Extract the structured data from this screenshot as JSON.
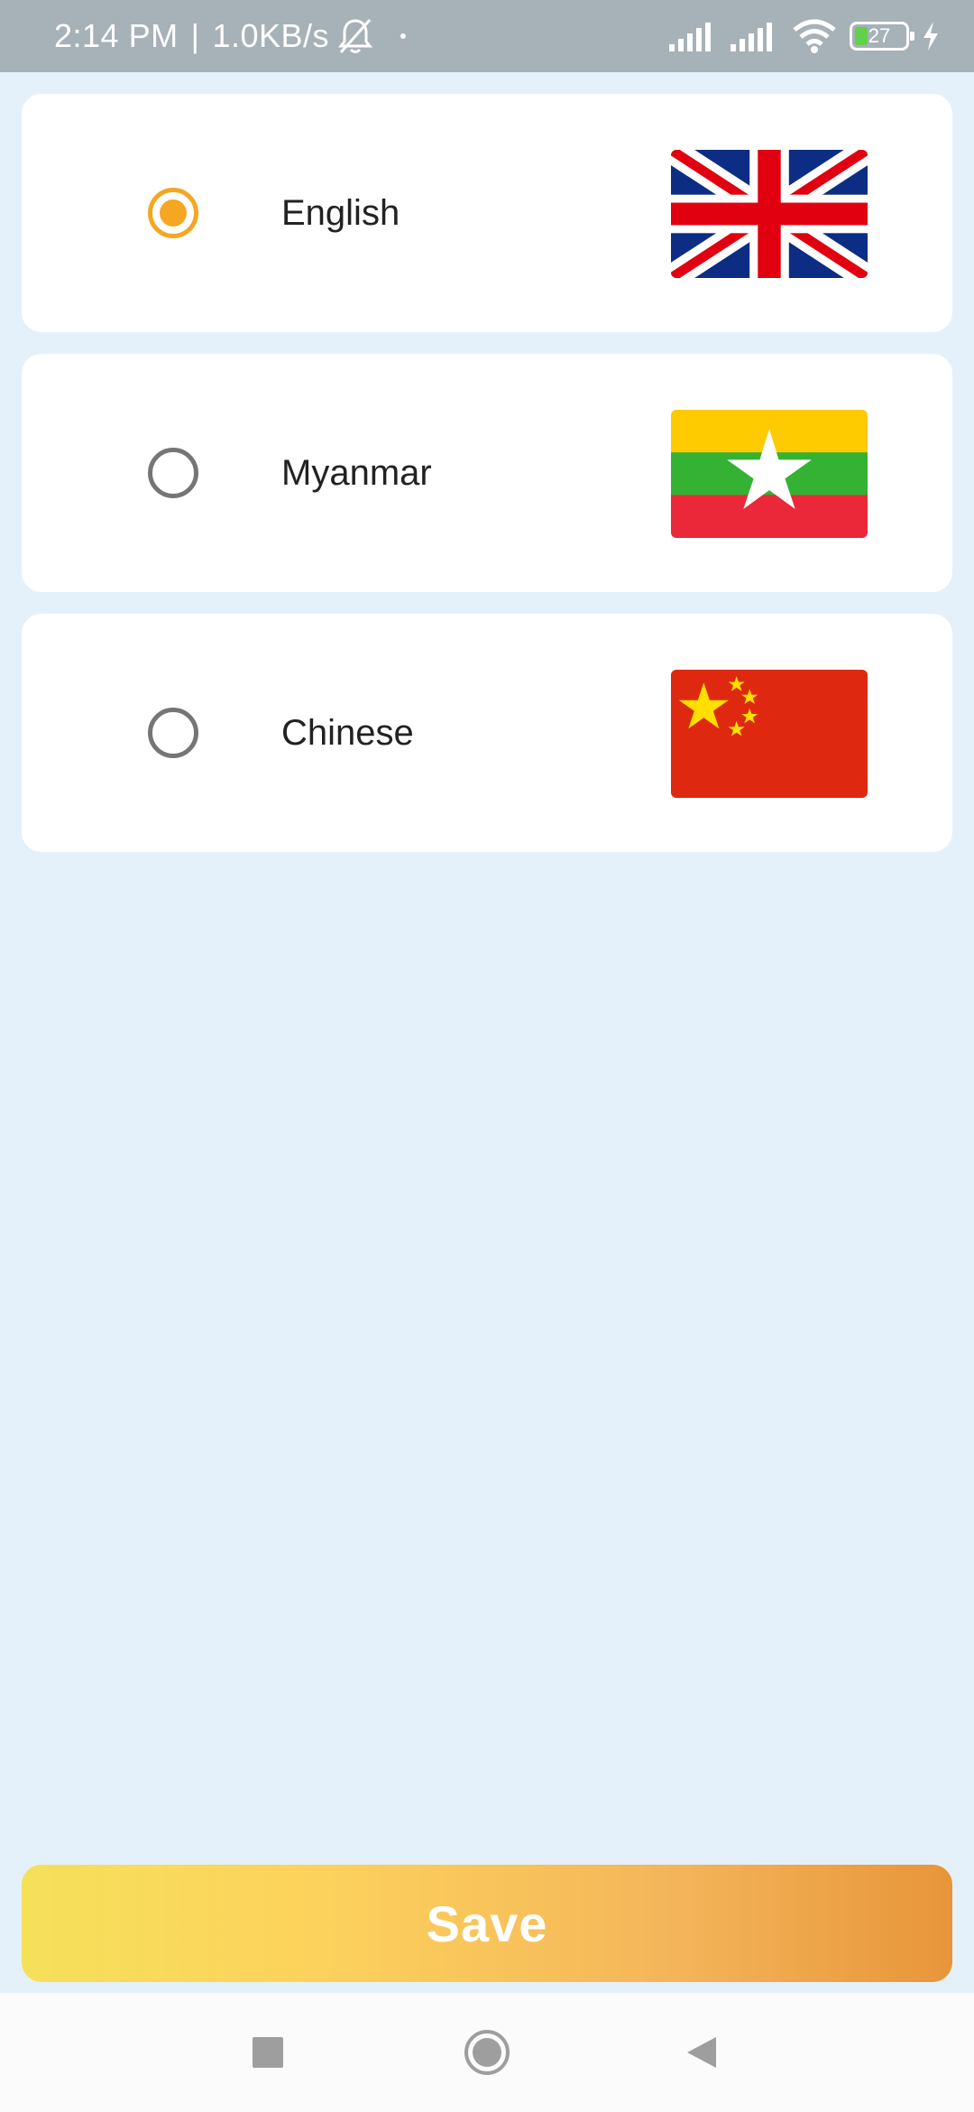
{
  "status_bar": {
    "time": "2:14 PM",
    "separator": "|",
    "network_speed": "1.0KB/s",
    "battery_level": "27",
    "icons": [
      "bell-off-icon",
      "dot-icon",
      "signal-icon",
      "signal-icon",
      "wifi-icon",
      "battery-icon",
      "charging-icon"
    ]
  },
  "languages": [
    {
      "label": "English",
      "selected": true,
      "flag": "uk-flag-icon"
    },
    {
      "label": "Myanmar",
      "selected": false,
      "flag": "myanmar-flag-icon"
    },
    {
      "label": "Chinese",
      "selected": false,
      "flag": "china-flag-icon"
    }
  ],
  "save_button": {
    "label": "Save"
  },
  "navigation": {
    "icons": [
      "recent-apps-icon",
      "home-icon",
      "back-icon"
    ]
  },
  "colors": {
    "background": "#e5f1fa",
    "accent": "#f5a623",
    "radio_unselected": "#757575",
    "save_gradient_start": "#f5e05a",
    "save_gradient_end": "#e8953a"
  }
}
